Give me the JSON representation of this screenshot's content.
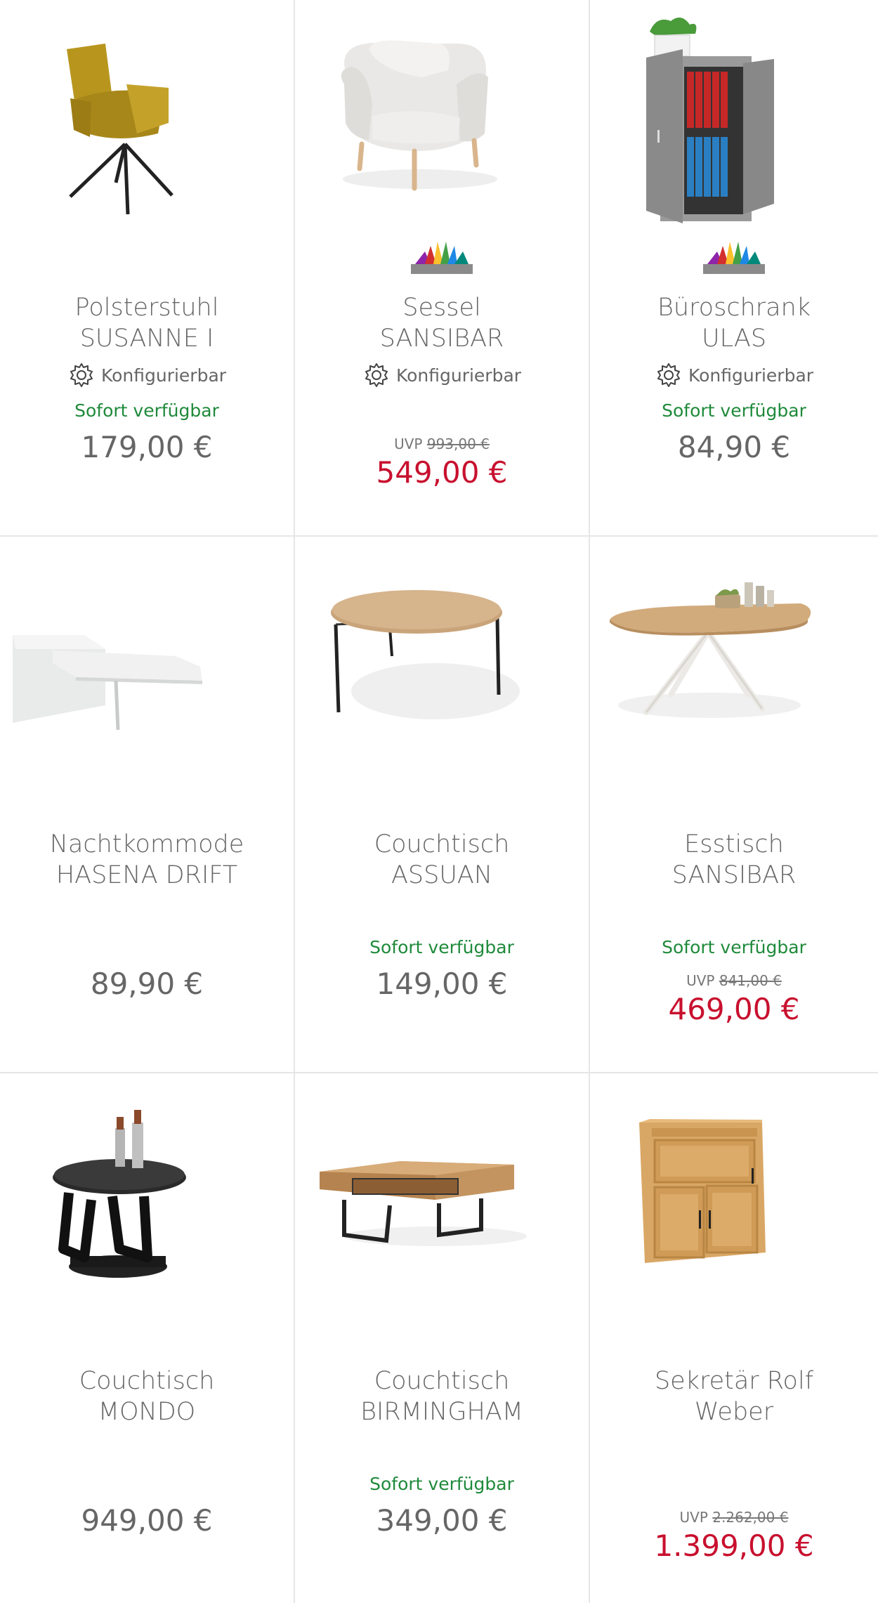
{
  "config_label": "Konfigurierbar",
  "avail_label": "Sofort verfügbar",
  "uvp_label": "UVP",
  "colors": {
    "sale": "#c8102e",
    "available": "#1f8a3b",
    "divider": "#e6e6e6",
    "text": "#666666"
  },
  "products": [
    {
      "line1": "Polsterstuhl",
      "line2": "SUSANNE I",
      "configurable": true,
      "available": true,
      "price": "179,00 €",
      "icon": "chair-image"
    },
    {
      "line1": "Sessel",
      "line2": "SANSIBAR",
      "configurable": true,
      "available": false,
      "uvp": "993,00 €",
      "price": "549,00 €",
      "color_palette": true,
      "icon": "armchair-image"
    },
    {
      "line1": "Büroschrank",
      "line2": "ULAS",
      "configurable": true,
      "available": true,
      "price": "84,90 €",
      "color_palette": true,
      "icon": "office-cabinet-image"
    },
    {
      "line1": "Nachtkommode",
      "line2": "HASENA DRIFT",
      "configurable": false,
      "available": false,
      "price": "89,90 €",
      "icon": "nightstand-image"
    },
    {
      "line1": "Couchtisch",
      "line2": "ASSUAN",
      "configurable": false,
      "available": true,
      "price": "149,00 €",
      "icon": "round-coffee-table-image"
    },
    {
      "line1": "Esstisch",
      "line2": "SANSIBAR",
      "configurable": false,
      "available": true,
      "uvp": "841,00 €",
      "price": "469,00 €",
      "icon": "dining-table-image"
    },
    {
      "line1": "Couchtisch",
      "line2": "MONDO",
      "configurable": false,
      "available": false,
      "price": "949,00 €",
      "icon": "swivel-coffee-table-image"
    },
    {
      "line1": "Couchtisch",
      "line2": "BIRMINGHAM",
      "configurable": false,
      "available": true,
      "price": "349,00 €",
      "icon": "wooden-coffee-table-image"
    },
    {
      "line1": "Sekretär Rolf",
      "line2": "Weber",
      "configurable": false,
      "available": false,
      "uvp": "2.262,00 €",
      "price": "1.399,00 €",
      "icon": "secretary-desk-image"
    }
  ]
}
